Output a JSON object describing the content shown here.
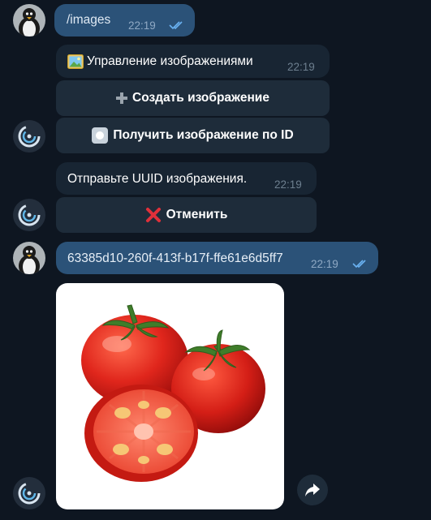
{
  "messages": {
    "cmd": {
      "text": "/images",
      "time": "22:19"
    },
    "menu": {
      "title": "Управление изображениями",
      "time": "22:19"
    },
    "prompt": {
      "text": "Отправьте UUID изображения.",
      "time": "22:19"
    },
    "uuid": {
      "text": "63385d10-260f-413f-b17f-ffe61e6d5ff7",
      "time": "22:19"
    }
  },
  "keyboard": {
    "create": "Создать изображение",
    "get_by_id": "Получить изображение по ID",
    "cancel": "Отменить"
  },
  "colors": {
    "background": "#0e1621",
    "outgoing_bubble": "#2b5278",
    "incoming_bubble": "#182533",
    "button": "#1e2c3a",
    "read_ticks": "#6ab2f2"
  },
  "icons": {
    "user_avatar": "penguin-avatar",
    "bot_avatar": "bot-logo-avatar",
    "menu": "picture-icon",
    "create": "plus-icon",
    "get_by_id": "record-icon",
    "cancel": "cross-icon",
    "forward": "share-arrow-icon",
    "read": "double-check-icon"
  }
}
